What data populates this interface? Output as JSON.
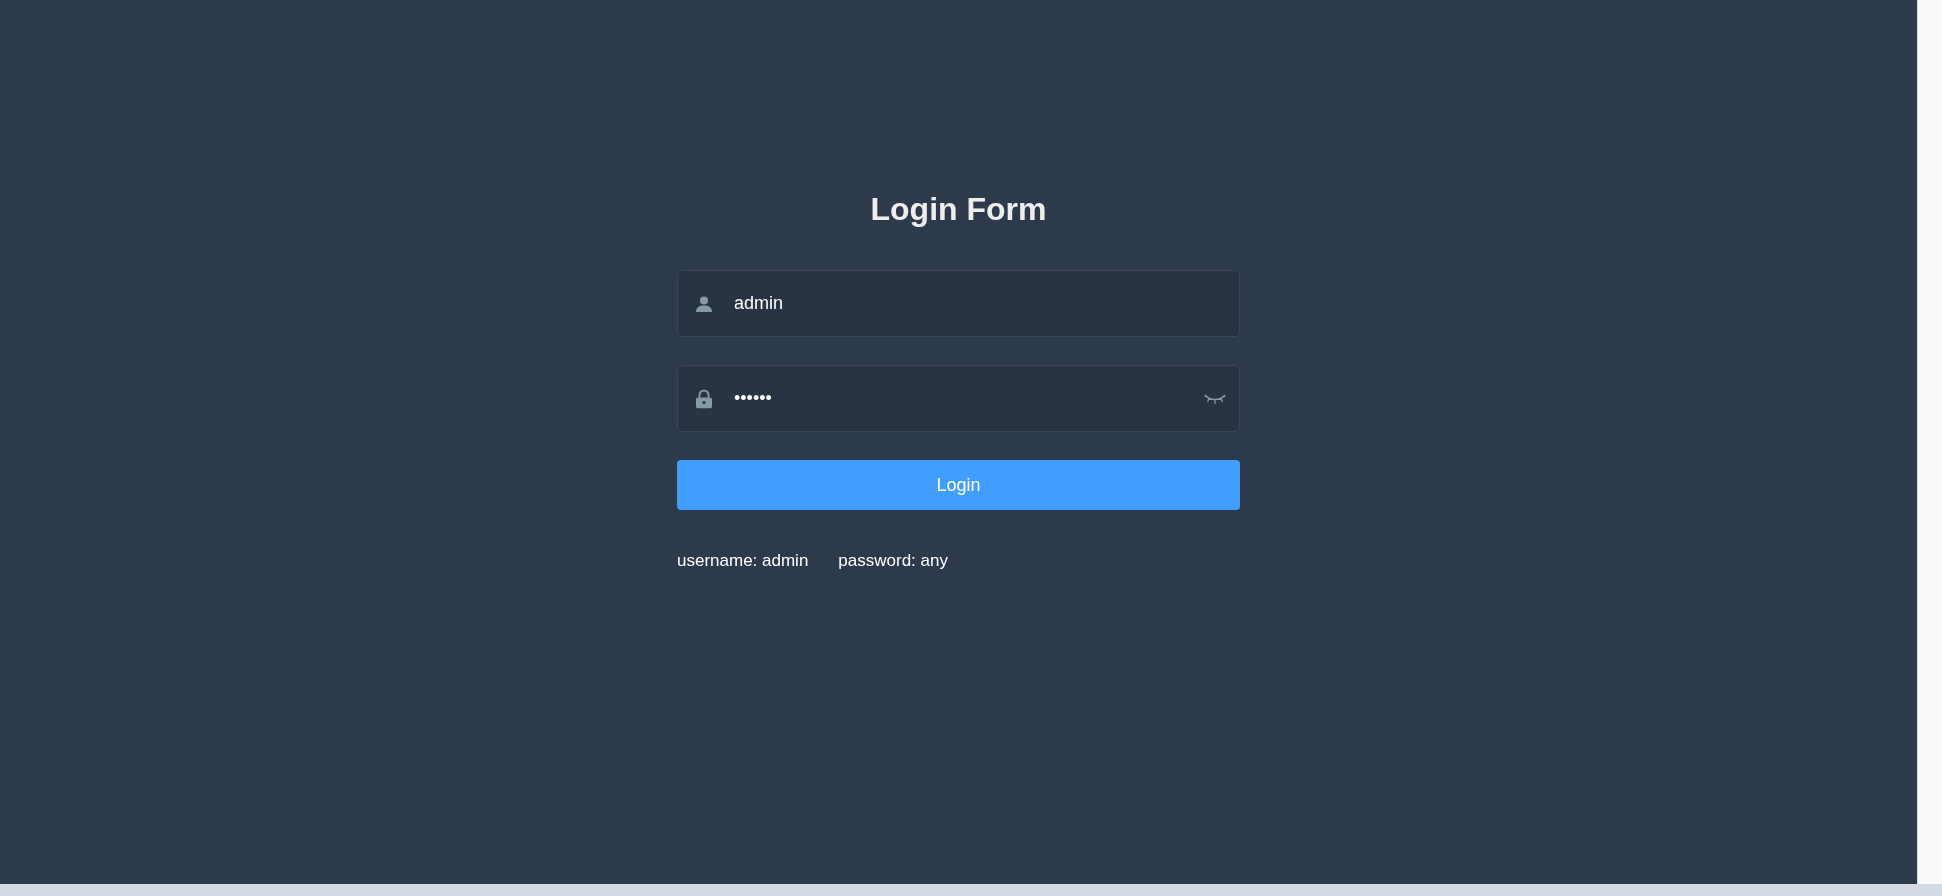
{
  "title": "Login Form",
  "fields": [
    {
      "kind": "username",
      "value": "admin"
    },
    {
      "kind": "password",
      "value": "••••••",
      "revealed": false
    }
  ],
  "button": "Login",
  "hints": [
    "username: admin",
    "password: any"
  ]
}
